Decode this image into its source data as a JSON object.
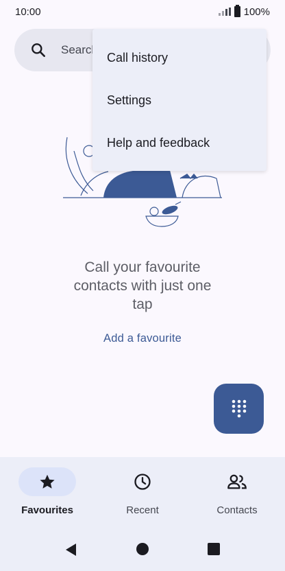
{
  "status": {
    "time": "10:00",
    "battery": "100%"
  },
  "search": {
    "placeholder": "Search"
  },
  "menu": {
    "items": [
      {
        "label": "Call history"
      },
      {
        "label": "Settings"
      },
      {
        "label": "Help and feedback"
      }
    ]
  },
  "empty_state": {
    "line1": "Call your favourite",
    "line2": "contacts with just one",
    "line3": "tap",
    "action": "Add a favourite"
  },
  "bottom_nav": {
    "items": [
      {
        "label": "Favourites",
        "icon": "star-icon",
        "active": true
      },
      {
        "label": "Recent",
        "icon": "clock-icon",
        "active": false
      },
      {
        "label": "Contacts",
        "icon": "people-icon",
        "active": false
      }
    ]
  },
  "colors": {
    "accent": "#3c5a95",
    "active_pill": "#dce3f9",
    "surface": "#eceef8",
    "background": "#fbf8fe"
  }
}
